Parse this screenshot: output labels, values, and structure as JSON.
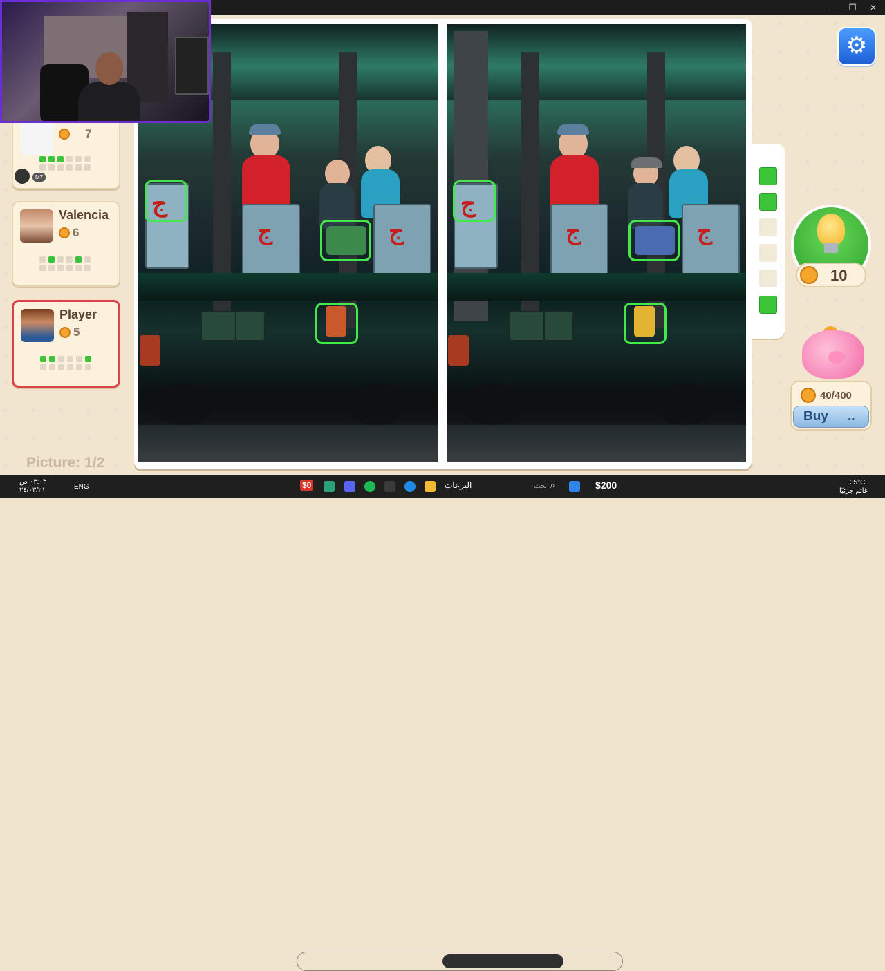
{
  "window": {
    "minimize": "—",
    "maximize": "❐",
    "close": "✕"
  },
  "players": [
    {
      "name": "",
      "score": "7",
      "progress": [
        1,
        1,
        1,
        0,
        0,
        0,
        0,
        0,
        0,
        0,
        0,
        0
      ],
      "tag": "M7"
    },
    {
      "name": "Valencia",
      "score": "6",
      "progress": [
        0,
        1,
        0,
        0,
        1,
        0,
        0,
        0,
        0,
        0,
        0,
        0
      ]
    },
    {
      "name": "Player",
      "score": "5",
      "progress": [
        1,
        1,
        0,
        0,
        0,
        1,
        0,
        0,
        0,
        0,
        0,
        0
      ],
      "active": true
    }
  ],
  "picture_label": "Picture: 1/2",
  "found_slots": [
    true,
    true,
    false,
    false,
    false,
    true
  ],
  "hint": {
    "count": "10"
  },
  "bank": {
    "amount": "40/400",
    "buy_label": "Buy",
    "buy_dots": ".."
  },
  "taskbar": {
    "time": "٠٣:٠٣ ص",
    "date": "٢٤/٠٣/٢١",
    "lang": "ENG",
    "search_placeholder": "بحث",
    "search_suggestion": "الترعات",
    "balance": "$200",
    "badge": "$0",
    "weather_temp": "35°C",
    "weather_desc": "غائم جزئيًا"
  }
}
